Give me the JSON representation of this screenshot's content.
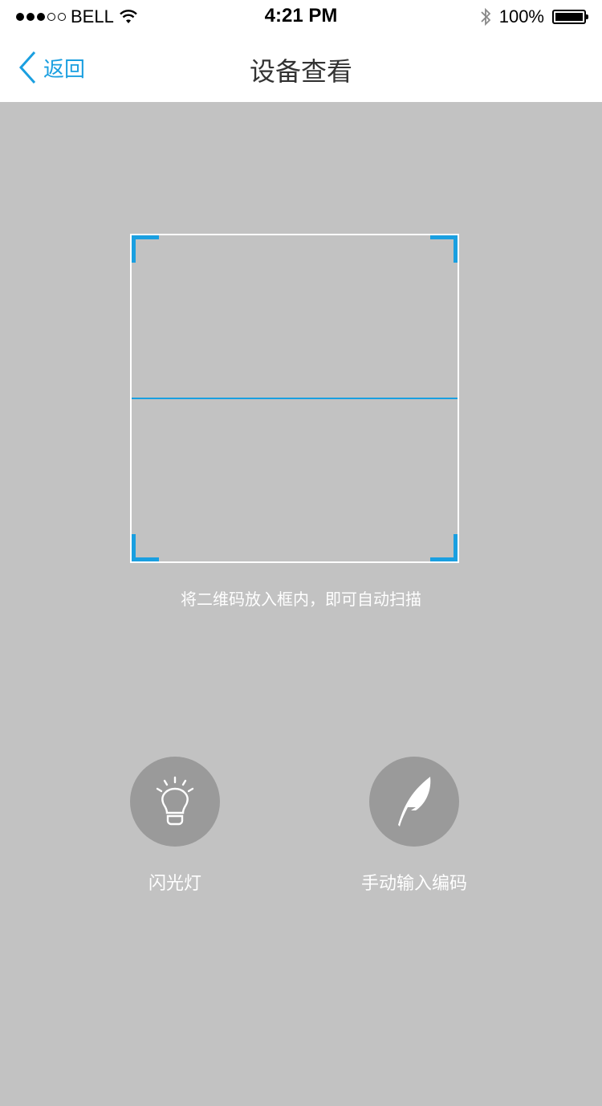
{
  "status_bar": {
    "carrier": "BELL",
    "time": "4:21 PM",
    "battery_percent": "100%"
  },
  "nav": {
    "back_label": "返回",
    "title": "设备查看"
  },
  "scanner": {
    "hint": "将二维码放入框内，即可自动扫描"
  },
  "actions": {
    "flashlight_label": "闪光灯",
    "manual_label": "手动输入编码"
  },
  "colors": {
    "accent": "#1a9fe0",
    "background": "#c2c2c2",
    "button_circle": "#9a9a9a"
  }
}
